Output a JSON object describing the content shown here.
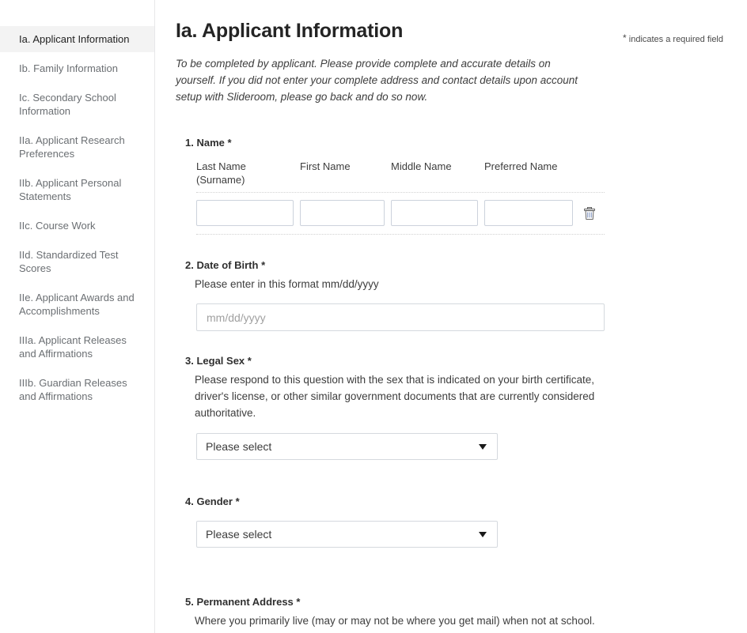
{
  "sidebar": {
    "items": [
      {
        "label": "Ia. Applicant Information",
        "active": true
      },
      {
        "label": "Ib. Family Information",
        "active": false
      },
      {
        "label": "Ic. Secondary School Information",
        "active": false
      },
      {
        "label": "IIa. Applicant Research Preferences",
        "active": false
      },
      {
        "label": "IIb. Applicant Personal Statements",
        "active": false
      },
      {
        "label": "IIc. Course Work",
        "active": false
      },
      {
        "label": "IId. Standardized Test Scores",
        "active": false
      },
      {
        "label": "IIe. Applicant Awards and Accomplishments",
        "active": false
      },
      {
        "label": "IIIa. Applicant Releases and Affirmations",
        "active": false
      },
      {
        "label": "IIIb. Guardian Releases and Affirmations",
        "active": false
      }
    ]
  },
  "header": {
    "title": "Ia. Applicant Information",
    "required_star": "*",
    "required_note": " indicates a required field",
    "intro": "To be completed by applicant. Please provide complete and accurate details on yourself. If you did not enter your complete address and contact details upon account setup with Slideroom, please go back and do so now."
  },
  "questions": {
    "q1": {
      "title": "1. Name *",
      "columns": [
        "Last Name (Surname)",
        "First Name",
        "Middle Name",
        "Preferred Name"
      ],
      "col_last_line1": "Last Name",
      "col_last_line2": "(Surname)",
      "col_first": "First Name",
      "col_middle": "Middle Name",
      "col_preferred": "Preferred Name",
      "row": {
        "last": "",
        "first": "",
        "middle": "",
        "preferred": ""
      },
      "delete_icon": "trash-icon"
    },
    "q2": {
      "title": "2. Date of Birth *",
      "desc": "Please enter in this format mm/dd/yyyy",
      "placeholder": "mm/dd/yyyy",
      "value": ""
    },
    "q3": {
      "title": "3. Legal Sex *",
      "desc": "Please respond to this question with the sex that is indicated on your birth certificate, driver's license, or other similar government documents that are currently considered authoritative.",
      "selected": "Please select"
    },
    "q4": {
      "title": "4. Gender *",
      "selected": "Please select"
    },
    "q5": {
      "title": "5. Permanent Address *",
      "desc": "Where you primarily live (may or may not be where you get mail) when not at school."
    }
  },
  "colors": {
    "active_nav_bg": "#f3f3f3",
    "nav_text": "#6b6f73",
    "input_border": "#ccd2dc",
    "divider": "#e7e7e9"
  }
}
